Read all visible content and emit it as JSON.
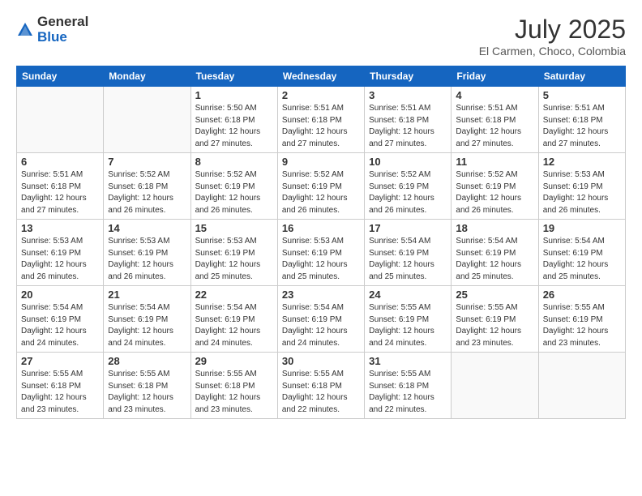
{
  "header": {
    "logo_general": "General",
    "logo_blue": "Blue",
    "month_year": "July 2025",
    "location": "El Carmen, Choco, Colombia"
  },
  "weekdays": [
    "Sunday",
    "Monday",
    "Tuesday",
    "Wednesday",
    "Thursday",
    "Friday",
    "Saturday"
  ],
  "weeks": [
    [
      {
        "day": "",
        "info": ""
      },
      {
        "day": "",
        "info": ""
      },
      {
        "day": "1",
        "sunrise": "5:50 AM",
        "sunset": "6:18 PM",
        "daylight": "12 hours and 27 minutes."
      },
      {
        "day": "2",
        "sunrise": "5:51 AM",
        "sunset": "6:18 PM",
        "daylight": "12 hours and 27 minutes."
      },
      {
        "day": "3",
        "sunrise": "5:51 AM",
        "sunset": "6:18 PM",
        "daylight": "12 hours and 27 minutes."
      },
      {
        "day": "4",
        "sunrise": "5:51 AM",
        "sunset": "6:18 PM",
        "daylight": "12 hours and 27 minutes."
      },
      {
        "day": "5",
        "sunrise": "5:51 AM",
        "sunset": "6:18 PM",
        "daylight": "12 hours and 27 minutes."
      }
    ],
    [
      {
        "day": "6",
        "sunrise": "5:51 AM",
        "sunset": "6:18 PM",
        "daylight": "12 hours and 27 minutes."
      },
      {
        "day": "7",
        "sunrise": "5:52 AM",
        "sunset": "6:18 PM",
        "daylight": "12 hours and 26 minutes."
      },
      {
        "day": "8",
        "sunrise": "5:52 AM",
        "sunset": "6:19 PM",
        "daylight": "12 hours and 26 minutes."
      },
      {
        "day": "9",
        "sunrise": "5:52 AM",
        "sunset": "6:19 PM",
        "daylight": "12 hours and 26 minutes."
      },
      {
        "day": "10",
        "sunrise": "5:52 AM",
        "sunset": "6:19 PM",
        "daylight": "12 hours and 26 minutes."
      },
      {
        "day": "11",
        "sunrise": "5:52 AM",
        "sunset": "6:19 PM",
        "daylight": "12 hours and 26 minutes."
      },
      {
        "day": "12",
        "sunrise": "5:53 AM",
        "sunset": "6:19 PM",
        "daylight": "12 hours and 26 minutes."
      }
    ],
    [
      {
        "day": "13",
        "sunrise": "5:53 AM",
        "sunset": "6:19 PM",
        "daylight": "12 hours and 26 minutes."
      },
      {
        "day": "14",
        "sunrise": "5:53 AM",
        "sunset": "6:19 PM",
        "daylight": "12 hours and 26 minutes."
      },
      {
        "day": "15",
        "sunrise": "5:53 AM",
        "sunset": "6:19 PM",
        "daylight": "12 hours and 25 minutes."
      },
      {
        "day": "16",
        "sunrise": "5:53 AM",
        "sunset": "6:19 PM",
        "daylight": "12 hours and 25 minutes."
      },
      {
        "day": "17",
        "sunrise": "5:54 AM",
        "sunset": "6:19 PM",
        "daylight": "12 hours and 25 minutes."
      },
      {
        "day": "18",
        "sunrise": "5:54 AM",
        "sunset": "6:19 PM",
        "daylight": "12 hours and 25 minutes."
      },
      {
        "day": "19",
        "sunrise": "5:54 AM",
        "sunset": "6:19 PM",
        "daylight": "12 hours and 25 minutes."
      }
    ],
    [
      {
        "day": "20",
        "sunrise": "5:54 AM",
        "sunset": "6:19 PM",
        "daylight": "12 hours and 24 minutes."
      },
      {
        "day": "21",
        "sunrise": "5:54 AM",
        "sunset": "6:19 PM",
        "daylight": "12 hours and 24 minutes."
      },
      {
        "day": "22",
        "sunrise": "5:54 AM",
        "sunset": "6:19 PM",
        "daylight": "12 hours and 24 minutes."
      },
      {
        "day": "23",
        "sunrise": "5:54 AM",
        "sunset": "6:19 PM",
        "daylight": "12 hours and 24 minutes."
      },
      {
        "day": "24",
        "sunrise": "5:55 AM",
        "sunset": "6:19 PM",
        "daylight": "12 hours and 24 minutes."
      },
      {
        "day": "25",
        "sunrise": "5:55 AM",
        "sunset": "6:19 PM",
        "daylight": "12 hours and 23 minutes."
      },
      {
        "day": "26",
        "sunrise": "5:55 AM",
        "sunset": "6:19 PM",
        "daylight": "12 hours and 23 minutes."
      }
    ],
    [
      {
        "day": "27",
        "sunrise": "5:55 AM",
        "sunset": "6:18 PM",
        "daylight": "12 hours and 23 minutes."
      },
      {
        "day": "28",
        "sunrise": "5:55 AM",
        "sunset": "6:18 PM",
        "daylight": "12 hours and 23 minutes."
      },
      {
        "day": "29",
        "sunrise": "5:55 AM",
        "sunset": "6:18 PM",
        "daylight": "12 hours and 23 minutes."
      },
      {
        "day": "30",
        "sunrise": "5:55 AM",
        "sunset": "6:18 PM",
        "daylight": "12 hours and 22 minutes."
      },
      {
        "day": "31",
        "sunrise": "5:55 AM",
        "sunset": "6:18 PM",
        "daylight": "12 hours and 22 minutes."
      },
      {
        "day": "",
        "info": ""
      },
      {
        "day": "",
        "info": ""
      }
    ]
  ]
}
